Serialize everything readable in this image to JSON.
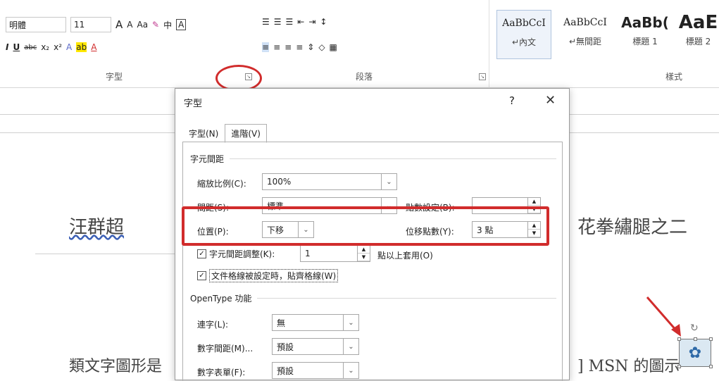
{
  "ribbon": {
    "font_name": "明體",
    "font_size": "11",
    "grow_font": "A",
    "shrink_font": "A",
    "change_case": "Aa",
    "phonetic": "中",
    "char_border": "A",
    "bold": "I",
    "underline": "U",
    "strike": "abc",
    "subscript": "x₂",
    "superscript": "x²",
    "highlight": "A",
    "font_color": "A",
    "group_font": "字型",
    "group_paragraph": "段落",
    "group_styles": "樣式",
    "styles": [
      {
        "sample": "AaBbCcI",
        "name": "↵內文"
      },
      {
        "sample": "AaBbCcI",
        "name": "↵無間距"
      },
      {
        "sample": "AaBb(",
        "name": "標題 1"
      },
      {
        "sample": "AaE",
        "name": "標題 2"
      }
    ]
  },
  "document": {
    "author": "汪群超",
    "right_title": "花拳繡腿之二",
    "body_left": "類文字圖形是",
    "body_right": "] MSN 的圖示"
  },
  "dialog": {
    "title": "字型",
    "help": "?",
    "close": "✕",
    "tabs": [
      "字型(N)",
      "進階(V)"
    ],
    "section_spacing": "字元間距",
    "scale_label": "縮放比例(C):",
    "scale_value": "100%",
    "spacing_label": "間距(S):",
    "spacing_value": "標準",
    "spacing_by_label": "點數設定(B):",
    "spacing_by_value": "",
    "position_label": "位置(P):",
    "position_value": "下移",
    "position_by_label": "位移點數(Y):",
    "position_by_value": "3 點",
    "kerning_label": "字元間距調整(K):",
    "kerning_value": "1",
    "kerning_suffix": "點以上套用(O)",
    "grid_label": "文件格線被設定時，貼齊格線(W)",
    "section_opentype": "OpenType 功能",
    "ligatures_label": "連字(L):",
    "ligatures_value": "無",
    "num_spacing_label": "數字間距(M)...",
    "num_spacing_value": "預設",
    "num_forms_label": "數字表單(F):",
    "num_forms_value": "預設"
  },
  "colors": {
    "annotation": "#d12c2c",
    "accent": "#2b579a"
  }
}
